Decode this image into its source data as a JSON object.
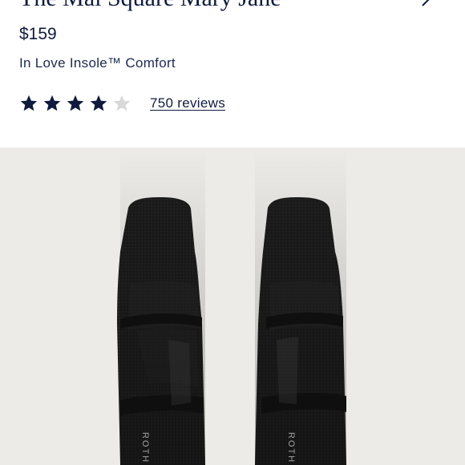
{
  "product": {
    "title": "The Mai Square Mary Jane",
    "price": "$159",
    "comfort_feature": "In Love Insole™ Comfort"
  },
  "rating": {
    "value": 4,
    "max": 5,
    "filled_color": "#0f1b3d",
    "empty_color": "#d9d9d9",
    "reviews_label": "750 reviews"
  },
  "image": {
    "background_color": "#ecebe7",
    "shoe_color": "#1b1b1b",
    "insole_text": "ROTHY'S",
    "icon": "shoe-product-photo"
  },
  "icons": {
    "share": "chevron-right-icon",
    "star": "star-icon"
  }
}
